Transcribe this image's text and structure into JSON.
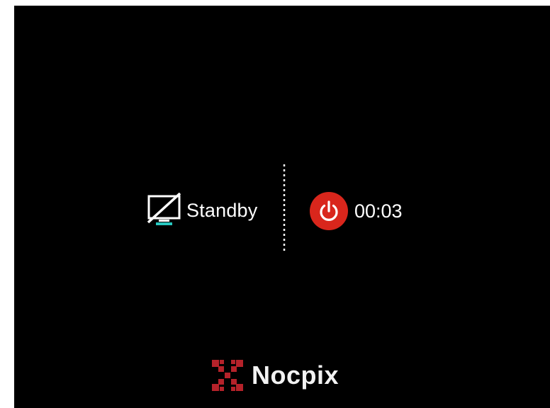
{
  "standby": {
    "label": "Standby",
    "icon": "display-off-icon"
  },
  "power": {
    "icon": "power-icon",
    "countdown": "00:03",
    "accent_color": "#d9261c"
  },
  "brand": {
    "name": "Nocpix",
    "logo_color": "#b5222a"
  }
}
